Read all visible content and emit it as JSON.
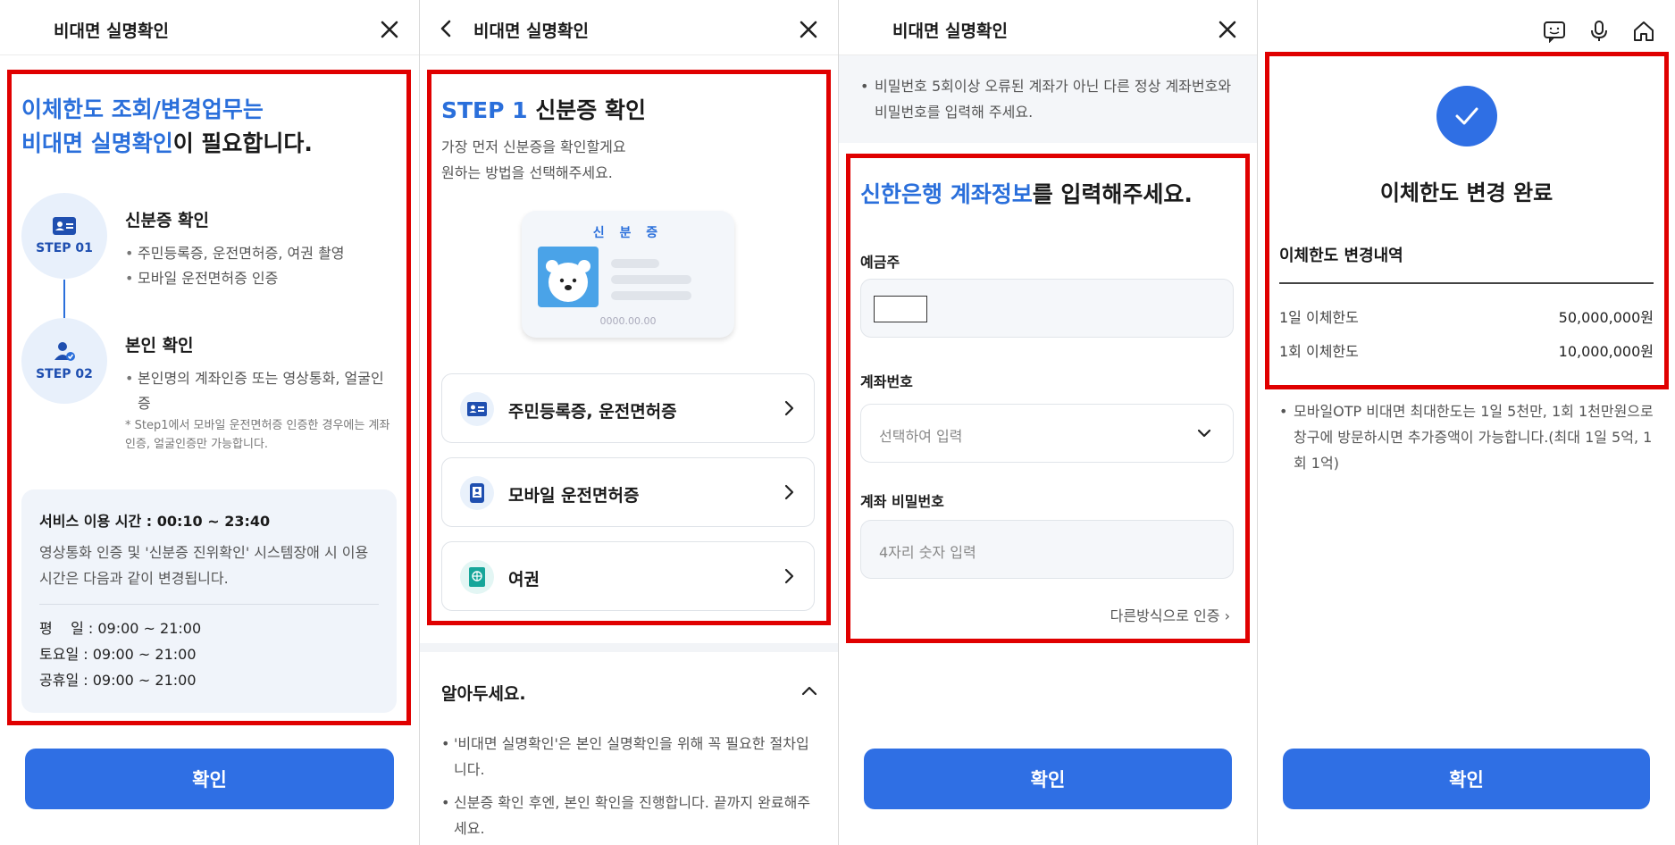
{
  "colors": {
    "accent": "#2f6fe4",
    "highlight": "#2a6fdb",
    "annotation": "#e00000"
  },
  "panel1": {
    "title": "비대면 실명확인",
    "headline_line1_blue": "이체한도 조회/변경업무는",
    "headline_line2_blue": "비대면 실명확인",
    "headline_line2_rest": "이 필요합니다.",
    "step1": {
      "label": "STEP 01",
      "title": "신분증 확인",
      "bullets": [
        "주민등록증, 운전면허증, 여권 촬영",
        "모바일 운전면허증 인증"
      ]
    },
    "step2": {
      "label": "STEP 02",
      "title": "본인 확인",
      "bullets": [
        "본인명의 계좌인증 또는 영상통화, 얼굴인증"
      ],
      "note": "* Step1에서 모바일 운전면허증 인증한 경우에는 계좌인증, 얼굴인증만 가능합니다."
    },
    "service": {
      "heading": "서비스 이용 시간 : 00:10 ~ 23:40",
      "desc": "영상통화 인증 및 '신분증 진위확인' 시스템장애 시 이용시간은 다음과 같이 변경됩니다.",
      "weekday": "평    일 : 09:00 ~ 21:00",
      "saturday": "토요일 : 09:00 ~ 21:00",
      "holiday": "공휴일 : 09:00 ~ 21:00"
    },
    "confirm": "확인"
  },
  "panel2": {
    "title": "비대면 실명확인",
    "step_blue": "STEP 1",
    "step_rest": " 신분증 확인",
    "sub_line1": "가장 먼저 신분증을 확인할게요",
    "sub_line2": "원하는 방법을 선택해주세요.",
    "card_title": "신 분 증",
    "card_date": "0000.00.00",
    "options": [
      "주민등록증, 운전면허증",
      "모바일 운전면허증",
      "여권"
    ],
    "know_title": "알아두세요.",
    "know_items": [
      "'비대면 실명확인'은 본인 실명확인을 위해 꼭 필요한 절차입니다.",
      "신분증 확인 후엔, 본인 확인을 진행합니다. 끝까지 완료해주세요."
    ]
  },
  "panel3": {
    "title": "비대면 실명확인",
    "top_note": "비밀번호 5회이상 오류된 계좌가 아닌 다른 정상 계좌번호와 비밀번호를 입력해 주세요.",
    "form_head_blue": "신한은행 계좌정보",
    "form_head_rest": "를 입력해주세요.",
    "depositor_label": "예금주",
    "account_label": "계좌번호",
    "account_placeholder": "선택하여 입력",
    "password_label": "계좌 비밀번호",
    "password_placeholder": "4자리 숫자 입력",
    "alt_link": "다른방식으로 인증",
    "confirm": "확인"
  },
  "panel4": {
    "done_title": "이체한도 변경 완료",
    "history_title": "이체한도 변경내역",
    "rows": [
      {
        "label": "1일 이체한도",
        "value": "50,000,000원"
      },
      {
        "label": "1회 이체한도",
        "value": "10,000,000원"
      }
    ],
    "footnote": "모바일OTP 비대면 최대한도는 1일 5천만, 1회 1천만원으로 창구에 방문하시면 추가증액이 가능합니다.(최대 1일 5억, 1회 1억)",
    "confirm": "확인",
    "icons": [
      "chat-icon",
      "mic-icon",
      "home-icon"
    ]
  }
}
